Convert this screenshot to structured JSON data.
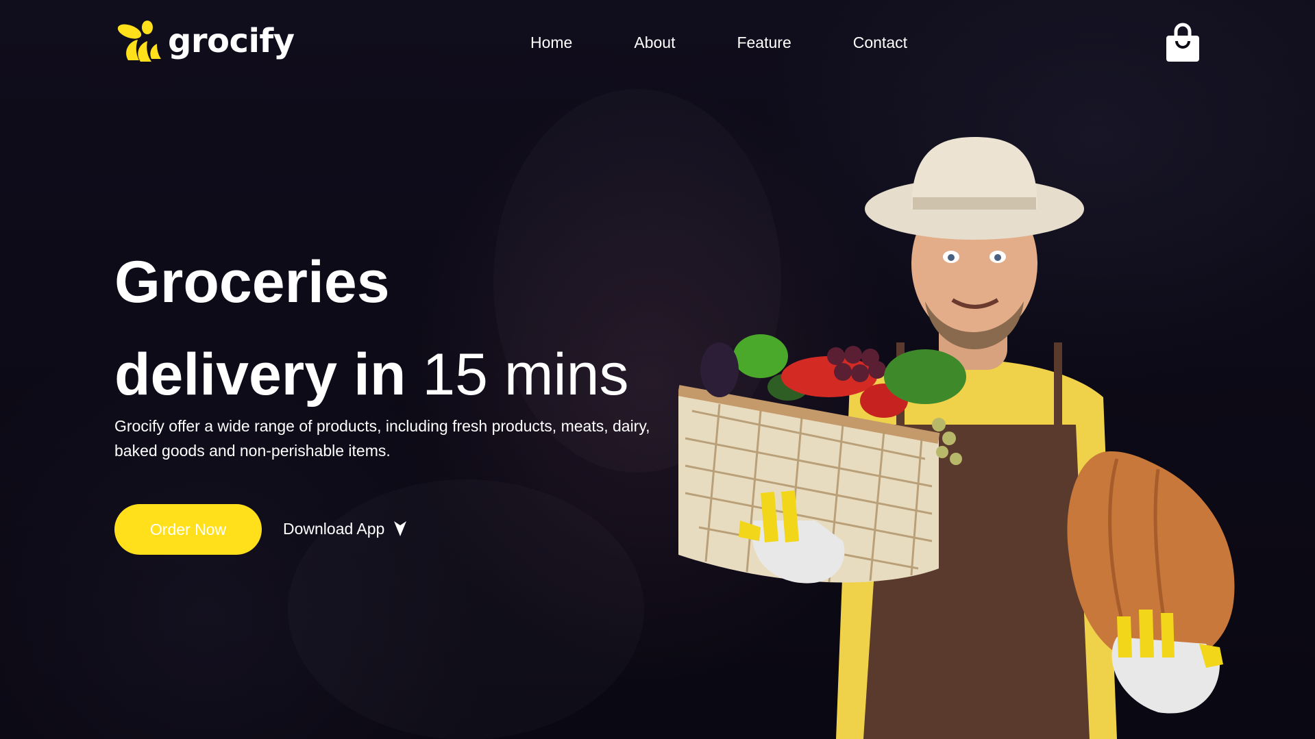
{
  "brand": {
    "name": "grocify",
    "accent_color": "#ffe01b",
    "logo_icon": "bee-logo-icon"
  },
  "nav": {
    "items": [
      {
        "label": "Home"
      },
      {
        "label": "About"
      },
      {
        "label": "Feature"
      },
      {
        "label": "Contact"
      }
    ],
    "cart_icon": "shopping-bag-icon"
  },
  "hero": {
    "title_line1": "Groceries",
    "title_line2_bold": "delivery in",
    "title_line2_light": " 15 mins",
    "description": "Grocify offer a wide range of products, including fresh products, meats, dairy, baked goods and non-perishable items.",
    "primary_button": "Order Now",
    "secondary_button": "Download App",
    "secondary_icon": "arrow-down-icon",
    "image_icon": "farmer-with-vegetable-basket-image"
  }
}
